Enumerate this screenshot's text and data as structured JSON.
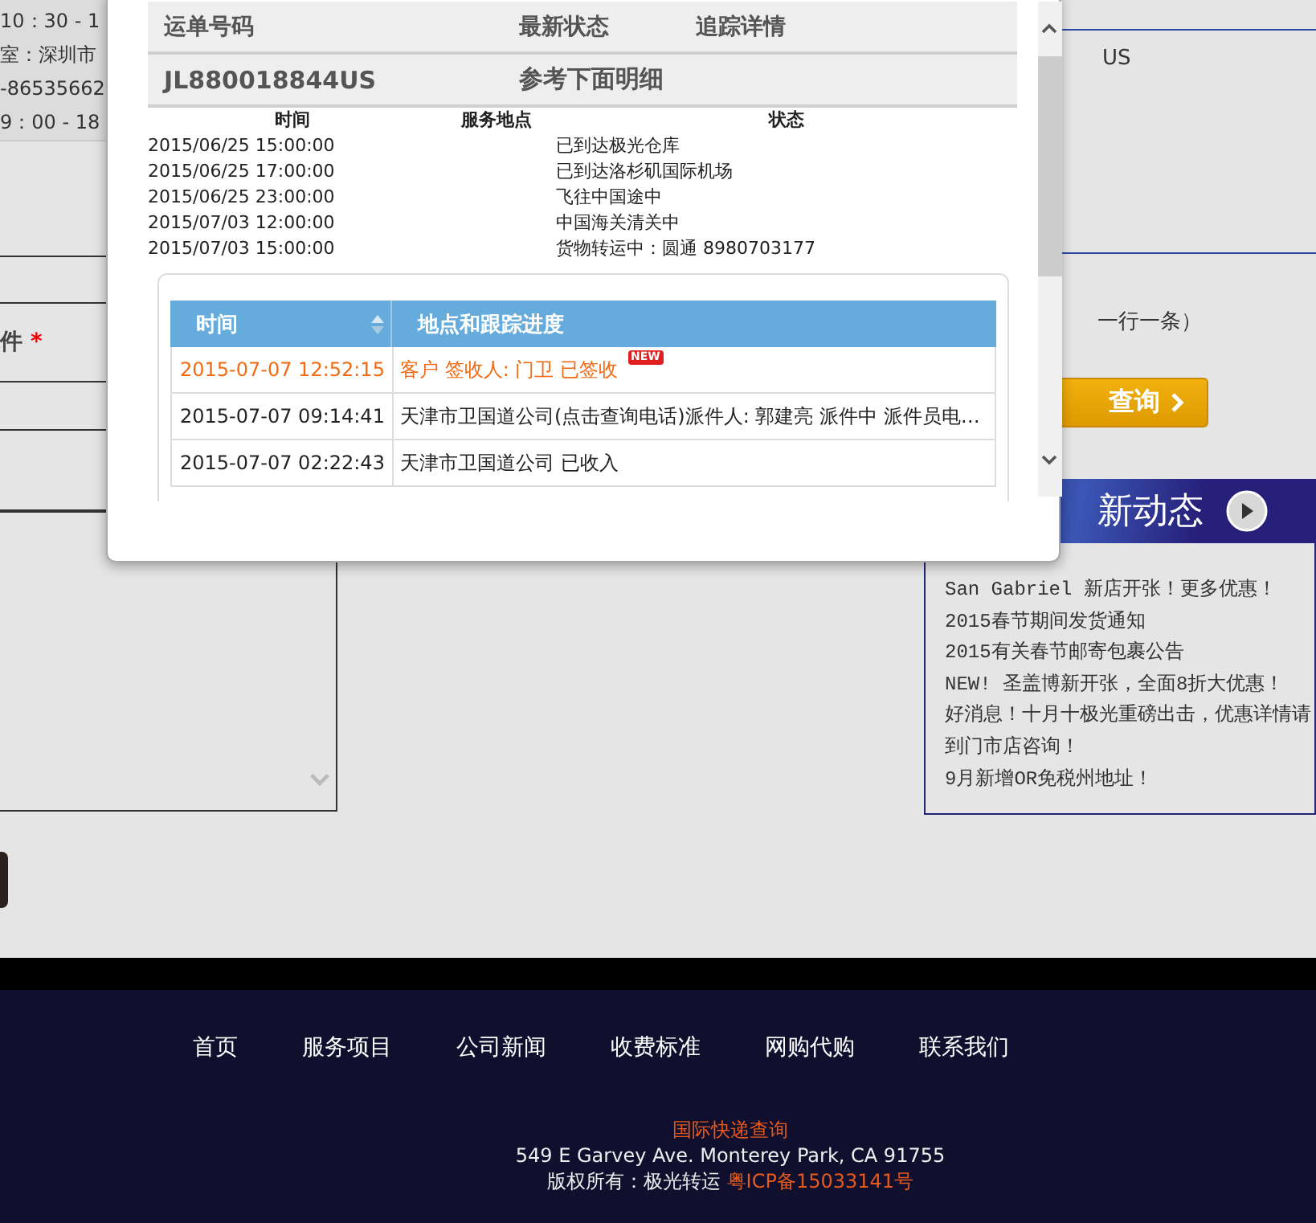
{
  "background_page": {
    "left_panel": {
      "info_lines": [
        "10：30 - 1",
        "室：深圳市",
        "-86535662",
        "9：00 - 18"
      ],
      "field_label": "件",
      "required_mark": "*"
    },
    "right_panel": {
      "number_fragment": "US",
      "hint_fragment": "一行一条）",
      "query_button": {
        "label": "查询"
      },
      "news_banner": {
        "title": "新动态"
      },
      "news_items": [
        {
          "lines": [
            "San Gabriel 新店开张！更多优惠！"
          ]
        },
        {
          "lines": [
            "2015春节期间发货通知"
          ]
        },
        {
          "lines": [
            "2015有关春节邮寄包裹公告"
          ]
        },
        {
          "lines": [
            "NEW! 圣盖博新开张，全面8折大优惠！"
          ]
        },
        {
          "lines": [
            "好消息！十月十极光重磅出击，优惠详情请",
            "到门市店咨询！"
          ]
        },
        {
          "lines": [
            "9月新增OR免税州地址！"
          ]
        }
      ]
    }
  },
  "dialog": {
    "summary_columns": [
      "运单号码",
      "最新状态",
      "追踪详情"
    ],
    "summary_row": [
      "JL880018844US",
      "参考下面明细"
    ],
    "detail_columns": [
      "时间",
      "服务地点",
      "状态"
    ],
    "detail_rows": [
      {
        "time": "2015/06/25 15:00:00",
        "status": "已到达极光仓库"
      },
      {
        "time": "2015/06/25 17:00:00",
        "status": "已到达洛杉矶国际机场"
      },
      {
        "time": "2015/06/25 23:00:00",
        "status": "飞往中国途中"
      },
      {
        "time": "2015/07/03 12:00:00",
        "status": "中国海关清关中"
      },
      {
        "time": "2015/07/03 15:00:00",
        "status": "货物转运中：圆通 8980703177"
      }
    ],
    "tracking_table": {
      "columns": [
        "时间",
        "地点和跟踪进度"
      ],
      "rows": [
        {
          "time": "2015-07-07 12:52:15",
          "progress": "客户 签收人: 门卫 已签收",
          "latest": true,
          "badge": "NEW"
        },
        {
          "time": "2015-07-07 09:14:41",
          "progress": "天津市卫国道公司(点击查询电话)派件人: 郭建亮 派件中 派件员电…",
          "latest": false
        },
        {
          "time": "2015-07-07 02:22:43",
          "progress": "天津市卫国道公司 已收入",
          "latest": false
        }
      ]
    }
  },
  "footer": {
    "nav": [
      "首页",
      "服务项目",
      "公司新闻",
      "收费标准",
      "网购代购",
      "联系我们"
    ],
    "query_link": "国际快递查询",
    "address": "549 E Garvey Ave. Monterey Park, CA 91755",
    "copyright": "版权所有：极光转运",
    "icp": "粤ICP备15033141号"
  }
}
